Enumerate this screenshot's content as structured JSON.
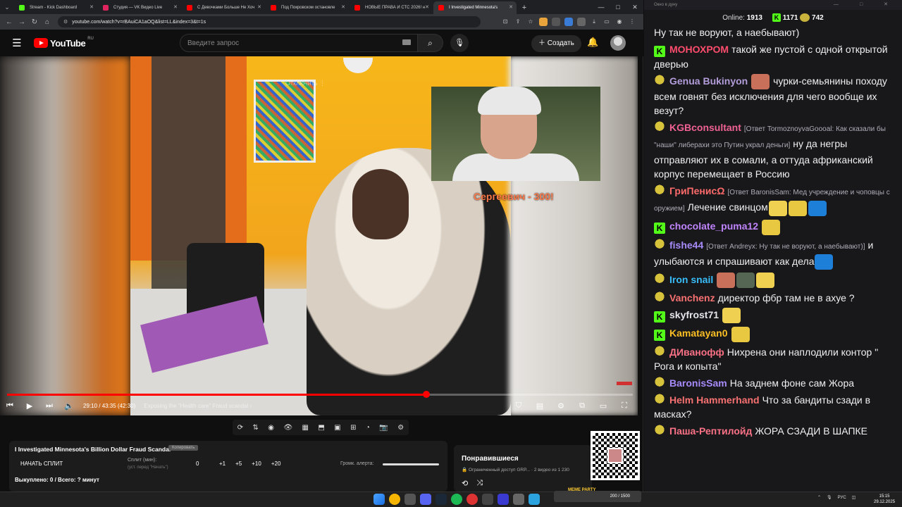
{
  "browser": {
    "tabs": [
      {
        "title": "Stream - Kick Dashboard",
        "color": "#53fc18",
        "active": false
      },
      {
        "title": "Студия — VK Видео Live",
        "color": "#e0245e",
        "active": false
      },
      {
        "title": "С Девочками Больше Не Хоч",
        "color": "#ff0000",
        "active": false
      },
      {
        "title": "Под Покровском остановле",
        "color": "#ff0000",
        "active": false
      },
      {
        "title": "НОВЫЕ ПРАВА И СТС 2026! н",
        "color": "#ff0000",
        "active": false
      },
      {
        "title": "I Investigated Minnesota's",
        "color": "#ff0000",
        "active": true
      }
    ],
    "url": "youtube.com/watch?v=rBAuiCA1aOQ&list=LL&index=3&t=1s"
  },
  "youtube": {
    "logo": "YouTube",
    "region": "RU",
    "search_placeholder": "Введите запрос",
    "create_label": "Создать"
  },
  "video": {
    "overlay_text": "Сергеевич - 300!",
    "ghost_button": "Отключить",
    "progress_fraction": 0.67,
    "time": "29:10 / 43:35 (42:30)",
    "chapter": "Exposing the \"Health care\" Fraud scandal"
  },
  "info": {
    "title": "I Investigated Minnesota's Billion Dollar Fraud Scandal",
    "copy_badge": "Копировать",
    "split_button": "НАЧАТЬ СПЛИТ",
    "split_label": "Сплит (мин):",
    "split_hint": "(уст. перед \"Начать\")",
    "split_value": "0",
    "split_options": [
      "+1",
      "+5",
      "+10",
      "+20"
    ],
    "alert_label": "Громк. алерта:",
    "bought": "Выкуплено: 0 / Всего: ? минут"
  },
  "liked": {
    "title": "Понравившиеся",
    "subtitle": "Ограниченный доступ GRP...",
    "subtitle_meta": "2 видео из 1 230"
  },
  "chat": {
    "window_title": "Окно в дуну",
    "online_label": "Online:",
    "online": "1913",
    "kick_count": "1171",
    "sub_count": "742",
    "messages": [
      {
        "user": "",
        "color": "#efeff1",
        "badge": "none",
        "reply": "",
        "text": "Ну так не воруют, а наебывают)",
        "emotes": 0
      },
      {
        "user": "МОНОХРОМ",
        "color": "#ff4d6d",
        "badge": "kick",
        "reply": "",
        "text": "такой же пустой с одной открытой дверью",
        "emotes": 0
      },
      {
        "user": "Genua Bukinyon",
        "color": "#b39ddb",
        "badge": "sub",
        "reply": "",
        "text": "чурки-семьянины походу всем говнят без исключения для чего вообще их везут?",
        "emotes": 1
      },
      {
        "user": "KGBconsultant",
        "color": "#f06292",
        "badge": "sub",
        "reply": "[Ответ TormoznoyvaGoooal: Как сказали бы \"наши\" либерахи это Путин украл деньги]",
        "text": "ну да негры отправляют их в сомали, а оттуда африканский корпус перемещает в Россию",
        "emotes": 0
      },
      {
        "user": "ГриПенисΩ",
        "color": "#ff6b6b",
        "badge": "sub",
        "reply": "[Ответ BaronisSam: Мед учреждение и чоповцы с оружием]",
        "text": "Лечение свинцом",
        "emotes": 3
      },
      {
        "user": "chocolate_puma12",
        "color": "#c084fc",
        "badge": "kick",
        "reply": "",
        "text": "",
        "emotes": 1
      },
      {
        "user": "fishe44",
        "color": "#a78bfa",
        "badge": "sub",
        "reply": "[Ответ Andreyx: Ну так не воруют, а наебывают)]",
        "text": "и улыбаются и спрашивают как дела",
        "emotes": 1
      },
      {
        "user": "Iron snail",
        "color": "#38bdf8",
        "badge": "sub",
        "reply": "",
        "text": "",
        "emotes": 3
      },
      {
        "user": "Vanchenz",
        "color": "#f87171",
        "badge": "sub",
        "reply": "",
        "text": "директор фбр там не в ахуе ?",
        "emotes": 0
      },
      {
        "user": "skyfrost71",
        "color": "#e5e7eb",
        "badge": "kick",
        "reply": "",
        "text": "",
        "emotes": 1
      },
      {
        "user": "Kamatayan0",
        "color": "#fbbf24",
        "badge": "kick",
        "reply": "",
        "text": "",
        "emotes": 1
      },
      {
        "user": "ДИванофф",
        "color": "#fb7185",
        "badge": "sub",
        "reply": "",
        "text": "Нихрена они наплодили контор \" Рога и копыта\"",
        "emotes": 0
      },
      {
        "user": "BaronisSam",
        "color": "#a78bfa",
        "badge": "sub",
        "reply": "",
        "text": "На заднем фоне сам Жора",
        "emotes": 0
      },
      {
        "user": "Helm Hammerhand",
        "color": "#f87171",
        "badge": "sub",
        "reply": "",
        "text": "Что за бандиты сзади в масках?",
        "emotes": 0
      },
      {
        "user": "Паша-Рептилойд",
        "color": "#fb7185",
        "badge": "sub",
        "reply": "",
        "text": "ЖОРА СЗАДИ В ШАПКЕ",
        "emotes": 0
      }
    ]
  },
  "taskbar": {
    "meme_label": "MEME PARTY",
    "meme_counter": "200 / 1500",
    "lang": "РУС",
    "time": "15:15",
    "date": "29.12.2025"
  }
}
